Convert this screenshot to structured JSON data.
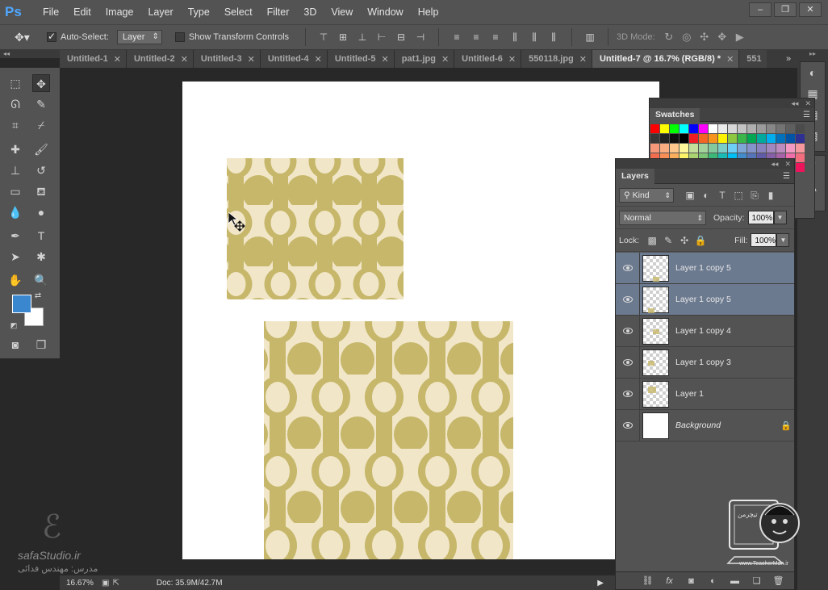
{
  "app": {
    "logo": "Ps"
  },
  "menu": [
    "File",
    "Edit",
    "Image",
    "Layer",
    "Type",
    "Select",
    "Filter",
    "3D",
    "View",
    "Window",
    "Help"
  ],
  "window_buttons": [
    "–",
    "❐",
    "✕"
  ],
  "options": {
    "auto_select_label": "Auto-Select:",
    "auto_select_value": "Layer",
    "show_transform_label": "Show Transform Controls",
    "mode_3d_label": "3D Mode:"
  },
  "tabs": [
    {
      "label": "Untitled-1",
      "active": false
    },
    {
      "label": "Untitled-2",
      "active": false
    },
    {
      "label": "Untitled-3",
      "active": false
    },
    {
      "label": "Untitled-4",
      "active": false
    },
    {
      "label": "Untitled-5",
      "active": false
    },
    {
      "label": "pat1.jpg",
      "active": false
    },
    {
      "label": "Untitled-6",
      "active": false
    },
    {
      "label": "550118.jpg",
      "active": false
    },
    {
      "label": "Untitled-7 @ 16.7% (RGB/8) *",
      "active": true
    },
    {
      "label": "551",
      "active": false
    }
  ],
  "tab_overflow": "»",
  "colors": {
    "foreground": "#3a87d0",
    "background": "#ffffff",
    "pattern_light": "#f1e6c8",
    "pattern_dark": "#c6b76a"
  },
  "status": {
    "zoom": "16.67%",
    "doc": "Doc: 35.9M/42.7M"
  },
  "swatches": {
    "title": "Swatches",
    "colors": [
      "#ff0000",
      "#ffff00",
      "#00ff00",
      "#00ffff",
      "#0000ff",
      "#ff00ff",
      "#ffffff",
      "#ebebeb",
      "#d7d7d7",
      "#c3c3c3",
      "#afafaf",
      "#9b9b9b",
      "#878787",
      "#737373",
      "#5f5f5f",
      "#4b4b4b",
      "#373737",
      "#232323",
      "#0f0f0f",
      "#000000",
      "#ee1d24",
      "#f26522",
      "#f7941d",
      "#fff200",
      "#8dc63f",
      "#39b54a",
      "#00a651",
      "#00a99d",
      "#00aeef",
      "#0072bc",
      "#0054a6",
      "#2e3192",
      "#f7977a",
      "#f9ad81",
      "#fdc68a",
      "#fff79a",
      "#c4df9b",
      "#a3d39c",
      "#82ca9d",
      "#7bcdc8",
      "#6ecff6",
      "#7ea7d8",
      "#8493ca",
      "#8882be",
      "#a187be",
      "#bc8cbf",
      "#f49ac2",
      "#f6989d",
      "#f26c4f",
      "#f68e55",
      "#fbaf5c",
      "#fff467",
      "#acd372",
      "#7cc576",
      "#3bb878",
      "#1abbb4",
      "#00bff3",
      "#438ccb",
      "#5574b9",
      "#605ca8",
      "#855fa8",
      "#a763a8",
      "#f06ea9",
      "#f26d7d",
      "#ed1c24",
      "#f26522",
      "#f7941d",
      "#fff200",
      "#8dc63f",
      "#39b54a",
      "#00a651",
      "#00a99d",
      "#00aeef",
      "#0072bc",
      "#0054a6",
      "#2e3192",
      "#662d91",
      "#92278f",
      "#ec008c",
      "#ed145b"
    ]
  },
  "layers": {
    "title": "Layers",
    "filter_kind": "Kind",
    "blend_mode": "Normal",
    "opacity_label": "Opacity:",
    "opacity_value": "100%",
    "lock_label": "Lock:",
    "fill_label": "Fill:",
    "fill_value": "100%",
    "items": [
      {
        "name": "Layer 1 copy 5",
        "selected": true,
        "background": false
      },
      {
        "name": "Layer 1 copy 5",
        "selected": true,
        "background": false
      },
      {
        "name": "Layer 1 copy 4",
        "selected": false,
        "background": false
      },
      {
        "name": "Layer 1 copy 3",
        "selected": false,
        "background": false
      },
      {
        "name": "Layer 1",
        "selected": false,
        "background": false
      },
      {
        "name": "Background",
        "selected": false,
        "background": true
      }
    ]
  },
  "watermark": {
    "site": "safaStudio.ir",
    "credit": "مدرس: مهندس فدائی",
    "teacher_url": "www.TeacherMan.ir"
  }
}
